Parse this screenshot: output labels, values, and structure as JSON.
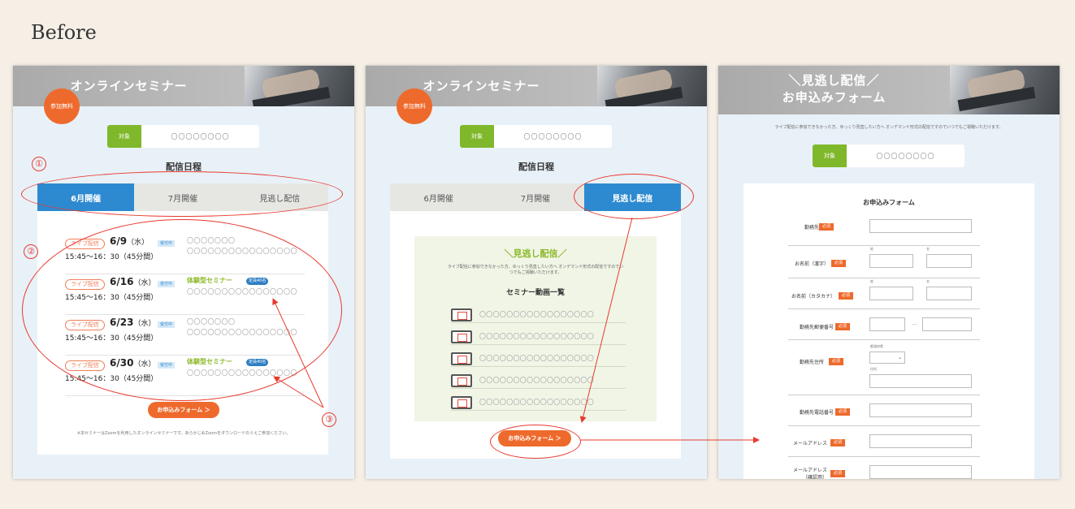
{
  "heading": "Before",
  "panel1": {
    "banner_title": "オンラインセミナー",
    "badge": "参加無料",
    "target_label": "対象",
    "target_value": "〇〇〇〇〇〇〇〇",
    "schedule_title": "配信日程",
    "tabs": [
      "6月開催",
      "7月開催",
      "見逃し配信"
    ],
    "rows": [
      {
        "type": "ライブ配信",
        "date": "6/9",
        "dow": "（水）",
        "accept": "受付中",
        "time": "15:45〜16：30（45分間）",
        "line1": "〇〇〇〇〇〇〇",
        "line2": "〇〇〇〇〇〇〇〇〇〇〇〇〇〇〇〇"
      },
      {
        "type": "ライブ配信",
        "date": "6/16",
        "dow": "（水）",
        "accept": "受付中",
        "time": "15:45〜16：30（45分間）",
        "experience": "体験型セミナー",
        "capacity": "定員40名",
        "line2": "〇〇〇〇〇〇〇〇〇〇〇〇〇〇〇〇"
      },
      {
        "type": "ライブ配信",
        "date": "6/23",
        "dow": "（水）",
        "accept": "受付中",
        "time": "15:45〜16：30（45分間）",
        "line1": "〇〇〇〇〇〇〇",
        "line2": "〇〇〇〇〇〇〇〇〇〇〇〇〇〇〇〇"
      },
      {
        "type": "ライブ配信",
        "date": "6/30",
        "dow": "（水）",
        "accept": "受付中",
        "time": "15:45〜16：30（45分間）",
        "experience": "体験型セミナー",
        "capacity": "定員40名",
        "line2": "〇〇〇〇〇〇〇〇〇〇〇〇〇〇〇〇"
      }
    ],
    "apply_button": "お申込みフォーム ＞",
    "note": "※本セミナーはZoomを利用したオンラインセミナーです。あらかじめZoomをダウンロードのうえご参加ください。"
  },
  "panel2": {
    "banner_title": "オンラインセミナー",
    "badge": "参加無料",
    "target_label": "対象",
    "target_value": "〇〇〇〇〇〇〇〇",
    "schedule_title": "配信日程",
    "tabs": [
      "6月開催",
      "7月開催",
      "見逃し配信"
    ],
    "missed_title": "＼見逃し配信／",
    "missed_desc": "ライブ配信に参加できなかった方、ゆっくり見直したい方へ オンデマンド形式の配信ですのでいつでもご視聴いただけます。",
    "video_list_title": "セミナー動画一覧",
    "videos": [
      "〇〇〇〇〇〇〇〇〇〇〇〇〇〇〇〇〇",
      "〇〇〇〇〇〇〇〇〇〇〇〇〇〇〇〇〇",
      "〇〇〇〇〇〇〇〇〇〇〇〇〇〇〇〇〇",
      "〇〇〇〇〇〇〇〇〇〇〇〇〇〇〇〇〇",
      "〇〇〇〇〇〇〇〇〇〇〇〇〇〇〇〇〇"
    ],
    "apply_button": "お申込みフォーム ＞"
  },
  "panel3": {
    "banner_title_1": "＼見逃し配信／",
    "banner_title_2": "お申込みフォーム",
    "intro": "ライブ配信に参加できなかった方、ゆっくり見直したい方へ オンデマンド形式の配信ですのでいつでもご視聴いただけます。",
    "target_label": "対象",
    "target_value": "〇〇〇〇〇〇〇〇",
    "form_title": "お申込みフォーム",
    "required": "必須",
    "fields": {
      "company": "勤務先",
      "name_kanji": "お名前（漢字）",
      "name_kana": "お名前（カタカナ）",
      "postal": "勤務先郵便番号",
      "address": "勤務先住所",
      "phone": "勤務先電話番号",
      "email": "メールアドレス",
      "email_confirm": "メールアドレス（確認用）"
    },
    "sub_sei": "姓",
    "sub_mei": "名",
    "sub_pref": "都道府県",
    "sub_addr": "住所",
    "postal_dash": "―"
  },
  "annotations": {
    "n1": "①",
    "n2": "②",
    "n3": "③"
  },
  "colors": {
    "accent_blue": "#2e8ad0",
    "accent_orange": "#ee6a2c",
    "accent_green": "#8ab827",
    "annotation_red": "#e8392e",
    "page_bg": "#f5efe6",
    "panel_bg": "#e9f1f8"
  }
}
